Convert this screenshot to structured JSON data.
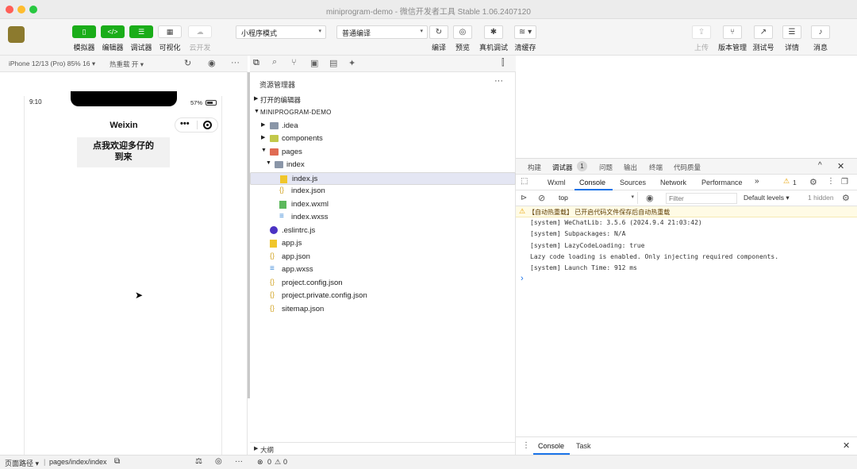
{
  "window": {
    "title": "miniprogram-demo - 微信开发者工具 Stable 1.06.2407120",
    "colors": {
      "close": "#ff5f57",
      "minimize": "#febc2e",
      "zoom": "#28c840",
      "accent_green": "#1aad19",
      "warning": "#e8a100"
    }
  },
  "toolbar": {
    "left_buttons": [
      {
        "label": "模拟器",
        "icon": "phone-icon"
      },
      {
        "label": "编辑器",
        "icon": "code-icon"
      },
      {
        "label": "调试器",
        "icon": "debug-icon"
      },
      {
        "label": "可视化",
        "icon": "grid-icon"
      },
      {
        "label": "云开发",
        "icon": "cloud-icon"
      }
    ],
    "mode_select": "小程序模式",
    "compile_select": "普通编译",
    "center_buttons": [
      {
        "label": "编译",
        "icon": "refresh-icon"
      },
      {
        "label": "预览",
        "icon": "eye-icon"
      },
      {
        "label": "真机调试",
        "icon": "bug-icon"
      },
      {
        "label": "清缓存",
        "icon": "layers-icon"
      }
    ],
    "right_buttons": [
      {
        "label": "上传",
        "icon": "upload-icon"
      },
      {
        "label": "版本管理",
        "icon": "branch-icon"
      },
      {
        "label": "测试号",
        "icon": "send-icon"
      },
      {
        "label": "详情",
        "icon": "menu-icon"
      },
      {
        "label": "消息",
        "icon": "bell-icon"
      }
    ]
  },
  "simulator": {
    "device": "iPhone 12/13 (Pro) 85% 16 ▾",
    "hotreload": "热重载 开 ▾",
    "status_time": "9:10",
    "battery": "57%",
    "nav_title": "Weixin",
    "capsule_dots": "•••",
    "page_text": "点我欢迎多仔的到来"
  },
  "explorer": {
    "title": "资源管理器",
    "open_editors": "打开的编辑器",
    "project": "MINIPROGRAM-DEMO",
    "outline": "大纲",
    "tree": [
      {
        "name": ".idea",
        "type": "folder"
      },
      {
        "name": "components",
        "type": "folder"
      },
      {
        "name": "pages",
        "type": "folder"
      },
      {
        "name": "index",
        "type": "folder"
      },
      {
        "name": "index.js",
        "type": "js"
      },
      {
        "name": "index.json",
        "type": "json"
      },
      {
        "name": "index.wxml",
        "type": "wxml"
      },
      {
        "name": "index.wxss",
        "type": "wxss"
      },
      {
        "name": ".eslintrc.js",
        "type": "eslint"
      },
      {
        "name": "app.js",
        "type": "js"
      },
      {
        "name": "app.json",
        "type": "json"
      },
      {
        "name": "app.wxss",
        "type": "wxss"
      },
      {
        "name": "project.config.json",
        "type": "json"
      },
      {
        "name": "project.private.config.json",
        "type": "json"
      },
      {
        "name": "sitemap.json",
        "type": "json"
      }
    ]
  },
  "devtools": {
    "top_tabs": [
      "构建",
      "调试器",
      "问题",
      "输出",
      "终端",
      "代码质量"
    ],
    "debugger_badge": "1",
    "sub_tabs": [
      "Wxml",
      "Console",
      "Sources",
      "Network",
      "Performance"
    ],
    "more": "»",
    "warn_count": "1",
    "context": "top",
    "filter_placeholder": "Filter",
    "levels": "Default levels ▾",
    "hidden": "1 hidden",
    "warning_line": "【自动热重载】 已开启代码文件保存后自动热重载",
    "logs": [
      "[system] WeChatLib: 3.5.6 (2024.9.4 21:03:42)",
      "[system] Subpackages: N/A",
      "[system] LazyCodeLoading: true",
      "Lazy code loading is enabled. Only injecting required components.",
      "[system] Launch Time: 912 ms"
    ],
    "prompt": "›",
    "drawer_tabs": [
      "Console",
      "Task"
    ]
  },
  "statusbar": {
    "path_label": "页面路径 ▾",
    "path": "pages/index/index",
    "errors": "0",
    "warnings": "0"
  }
}
